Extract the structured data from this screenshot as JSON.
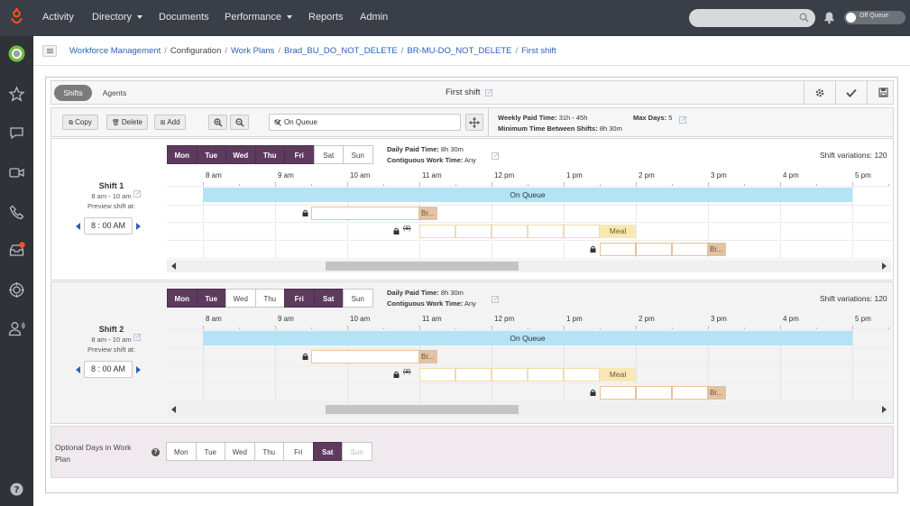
{
  "topnav": {
    "items": [
      {
        "label": "Activity",
        "dropdown": false
      },
      {
        "label": "Directory",
        "dropdown": true
      },
      {
        "label": "Documents",
        "dropdown": false
      },
      {
        "label": "Performance",
        "dropdown": true
      },
      {
        "label": "Reports",
        "dropdown": false
      },
      {
        "label": "Admin",
        "dropdown": false
      }
    ],
    "search_placeholder": "",
    "status_toggle": "Off Queue"
  },
  "leftrail": {
    "icons": [
      "genesys-logo",
      "user-status-icon",
      "star-icon",
      "chat-icon",
      "video-icon",
      "phone-icon",
      "inbox-icon",
      "target-icon",
      "agent-icon",
      "help-icon"
    ]
  },
  "breadcrumb": [
    {
      "label": "Workforce Management",
      "link": true
    },
    {
      "label": "Configuration",
      "link": false
    },
    {
      "label": "Work Plans",
      "link": true
    },
    {
      "label": "Brad_BU_DO_NOT_DELETE",
      "link": true
    },
    {
      "label": "BR-MU-DO_NOT_DELETE",
      "link": true
    },
    {
      "label": "First shift",
      "link": true
    }
  ],
  "header": {
    "tabs": [
      "Shifts",
      "Agents"
    ],
    "active_tab": "Shifts",
    "title": "First shift"
  },
  "toolbar": {
    "copy": "Copy",
    "delete": "Delete",
    "add": "Add",
    "queue": "On Queue",
    "weekly_paid_time_label": "Weekly Paid Time:",
    "weekly_paid_time_value": "31h - 45h",
    "max_days_label": "Max Days:",
    "max_days_value": "5",
    "min_time_label": "Minimum Time Between Shifts:",
    "min_time_value": "8h 30m"
  },
  "hours": [
    "8 am",
    "9 am",
    "10 am",
    "11 am",
    "12 pm",
    "1 pm",
    "2 pm",
    "3 pm",
    "4 pm",
    "5 pm"
  ],
  "shifts": [
    {
      "name": "Shift 1",
      "time": "8 am - 10 am",
      "preview_label": "Preview shift at:",
      "preview_time": "8 : 00  AM",
      "days": [
        {
          "label": "Mon",
          "on": true
        },
        {
          "label": "Tue",
          "on": true
        },
        {
          "label": "Wed",
          "on": true
        },
        {
          "label": "Thu",
          "on": true
        },
        {
          "label": "Fri",
          "on": true
        },
        {
          "label": "Sat",
          "on": false
        },
        {
          "label": "Sun",
          "on": false
        }
      ],
      "daily_paid_label": "Daily Paid Time:",
      "daily_paid_value": "8h 30m",
      "contiguous_label": "Contiguous Work Time:",
      "contiguous_value": "Any",
      "variations": "Shift variations: 120",
      "activity": "On Queue",
      "break_label": "Br...",
      "meal_label": "Meal",
      "struck_label": "(8)"
    },
    {
      "name": "Shift 2",
      "time": "8 am - 10 am",
      "preview_label": "Preview shift at:",
      "preview_time": "8 : 00  AM",
      "days": [
        {
          "label": "Mon",
          "on": true
        },
        {
          "label": "Tue",
          "on": true
        },
        {
          "label": "Wed",
          "on": false
        },
        {
          "label": "Thu",
          "on": false
        },
        {
          "label": "Fri",
          "on": true
        },
        {
          "label": "Sat",
          "on": true
        },
        {
          "label": "Sun",
          "on": false
        }
      ],
      "daily_paid_label": "Daily Paid Time:",
      "daily_paid_value": "8h 30m",
      "contiguous_label": "Contiguous Work Time:",
      "contiguous_value": "Any",
      "variations": "Shift variations: 120",
      "activity": "On Queue",
      "break_label": "Br...",
      "meal_label": "Meal",
      "struck_label": "(8)"
    }
  ],
  "optional_days": {
    "label": "Optional Days in Work Plan",
    "days": [
      {
        "label": "Mon",
        "state": "off"
      },
      {
        "label": "Tue",
        "state": "off"
      },
      {
        "label": "Wed",
        "state": "off"
      },
      {
        "label": "Thu",
        "state": "off"
      },
      {
        "label": "Fri",
        "state": "off"
      },
      {
        "label": "Sat",
        "state": "on"
      },
      {
        "label": "Sun",
        "state": "disabled"
      }
    ]
  },
  "colors": {
    "topbar": "#3a3f47",
    "leftrail": "#2f3237",
    "day_selected": "#5e3b5e",
    "on_queue": "#b3e3f5",
    "break": "#e2c2a2",
    "meal": "#f8e8b4",
    "link": "#2a60b7"
  }
}
